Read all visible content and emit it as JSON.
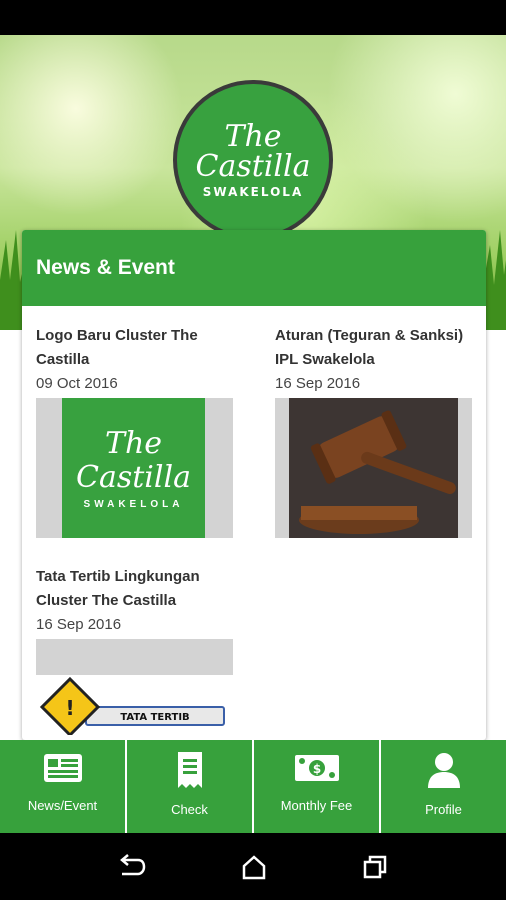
{
  "app": {
    "logo": {
      "line1": "The",
      "line2": "Castilla",
      "line3": "SWAKELOLA"
    }
  },
  "section": {
    "title": "News & Event"
  },
  "news": [
    {
      "title": "Logo Baru Cluster The Castilla",
      "date": "09 Oct 2016",
      "image": "castilla-logo"
    },
    {
      "title": "Aturan (Teguran & Sanksi) IPL Swakelola",
      "date": "16 Sep 2016",
      "image": "gavel"
    },
    {
      "title": "Tata Tertib Lingkungan Cluster The Castilla",
      "date": "16 Sep 2016",
      "image": "tata-tertib-sign",
      "image_caption": "TATA TERTIB"
    }
  ],
  "bottom_nav": [
    {
      "label": "News/Event",
      "icon": "newspaper-icon"
    },
    {
      "label": "Check",
      "icon": "receipt-icon"
    },
    {
      "label": "Monthly Fee",
      "icon": "money-icon"
    },
    {
      "label": "Profile",
      "icon": "person-icon"
    }
  ],
  "colors": {
    "brand_green": "#37a13c",
    "logo_border": "#3a3a3a"
  }
}
